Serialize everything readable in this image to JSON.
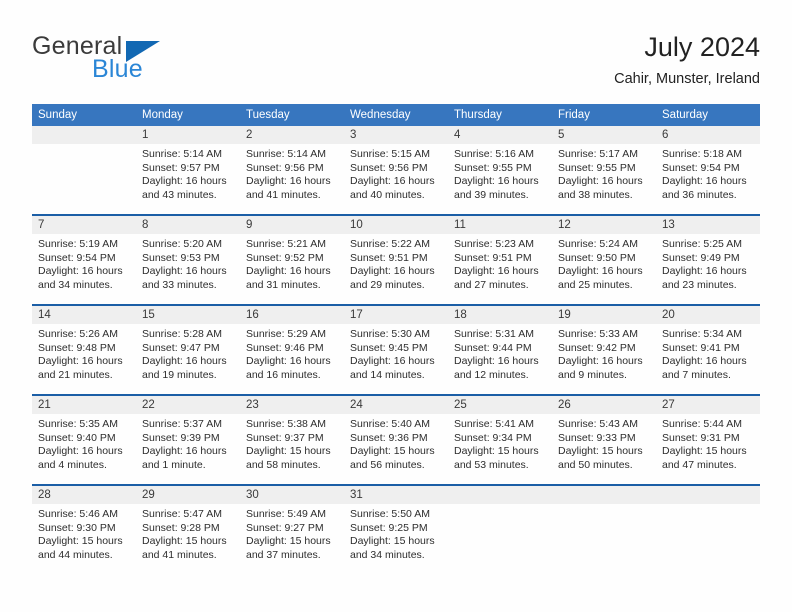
{
  "brand": {
    "name_top": "General",
    "name_bottom": "Blue",
    "triangle_color": "#1268b3",
    "blue_text_color": "#2b86d6"
  },
  "header": {
    "title": "July 2024",
    "subtitle": "Cahir, Munster, Ireland"
  },
  "theme": {
    "header_blue": "#3776bf",
    "week_rule_blue": "#1b5ea6",
    "number_band": "#efefef",
    "page_background": "#fefefe"
  },
  "weekdays": [
    "Sunday",
    "Monday",
    "Tuesday",
    "Wednesday",
    "Thursday",
    "Friday",
    "Saturday"
  ],
  "weeks": [
    {
      "numbers": [
        "",
        "1",
        "2",
        "3",
        "4",
        "5",
        "6"
      ],
      "cells": [
        {
          "sunrise": "",
          "sunset": "",
          "daylight1": "",
          "daylight2": ""
        },
        {
          "sunrise": "Sunrise: 5:14 AM",
          "sunset": "Sunset: 9:57 PM",
          "daylight1": "Daylight: 16 hours",
          "daylight2": "and 43 minutes."
        },
        {
          "sunrise": "Sunrise: 5:14 AM",
          "sunset": "Sunset: 9:56 PM",
          "daylight1": "Daylight: 16 hours",
          "daylight2": "and 41 minutes."
        },
        {
          "sunrise": "Sunrise: 5:15 AM",
          "sunset": "Sunset: 9:56 PM",
          "daylight1": "Daylight: 16 hours",
          "daylight2": "and 40 minutes."
        },
        {
          "sunrise": "Sunrise: 5:16 AM",
          "sunset": "Sunset: 9:55 PM",
          "daylight1": "Daylight: 16 hours",
          "daylight2": "and 39 minutes."
        },
        {
          "sunrise": "Sunrise: 5:17 AM",
          "sunset": "Sunset: 9:55 PM",
          "daylight1": "Daylight: 16 hours",
          "daylight2": "and 38 minutes."
        },
        {
          "sunrise": "Sunrise: 5:18 AM",
          "sunset": "Sunset: 9:54 PM",
          "daylight1": "Daylight: 16 hours",
          "daylight2": "and 36 minutes."
        }
      ]
    },
    {
      "numbers": [
        "7",
        "8",
        "9",
        "10",
        "11",
        "12",
        "13"
      ],
      "cells": [
        {
          "sunrise": "Sunrise: 5:19 AM",
          "sunset": "Sunset: 9:54 PM",
          "daylight1": "Daylight: 16 hours",
          "daylight2": "and 34 minutes."
        },
        {
          "sunrise": "Sunrise: 5:20 AM",
          "sunset": "Sunset: 9:53 PM",
          "daylight1": "Daylight: 16 hours",
          "daylight2": "and 33 minutes."
        },
        {
          "sunrise": "Sunrise: 5:21 AM",
          "sunset": "Sunset: 9:52 PM",
          "daylight1": "Daylight: 16 hours",
          "daylight2": "and 31 minutes."
        },
        {
          "sunrise": "Sunrise: 5:22 AM",
          "sunset": "Sunset: 9:51 PM",
          "daylight1": "Daylight: 16 hours",
          "daylight2": "and 29 minutes."
        },
        {
          "sunrise": "Sunrise: 5:23 AM",
          "sunset": "Sunset: 9:51 PM",
          "daylight1": "Daylight: 16 hours",
          "daylight2": "and 27 minutes."
        },
        {
          "sunrise": "Sunrise: 5:24 AM",
          "sunset": "Sunset: 9:50 PM",
          "daylight1": "Daylight: 16 hours",
          "daylight2": "and 25 minutes."
        },
        {
          "sunrise": "Sunrise: 5:25 AM",
          "sunset": "Sunset: 9:49 PM",
          "daylight1": "Daylight: 16 hours",
          "daylight2": "and 23 minutes."
        }
      ]
    },
    {
      "numbers": [
        "14",
        "15",
        "16",
        "17",
        "18",
        "19",
        "20"
      ],
      "cells": [
        {
          "sunrise": "Sunrise: 5:26 AM",
          "sunset": "Sunset: 9:48 PM",
          "daylight1": "Daylight: 16 hours",
          "daylight2": "and 21 minutes."
        },
        {
          "sunrise": "Sunrise: 5:28 AM",
          "sunset": "Sunset: 9:47 PM",
          "daylight1": "Daylight: 16 hours",
          "daylight2": "and 19 minutes."
        },
        {
          "sunrise": "Sunrise: 5:29 AM",
          "sunset": "Sunset: 9:46 PM",
          "daylight1": "Daylight: 16 hours",
          "daylight2": "and 16 minutes."
        },
        {
          "sunrise": "Sunrise: 5:30 AM",
          "sunset": "Sunset: 9:45 PM",
          "daylight1": "Daylight: 16 hours",
          "daylight2": "and 14 minutes."
        },
        {
          "sunrise": "Sunrise: 5:31 AM",
          "sunset": "Sunset: 9:44 PM",
          "daylight1": "Daylight: 16 hours",
          "daylight2": "and 12 minutes."
        },
        {
          "sunrise": "Sunrise: 5:33 AM",
          "sunset": "Sunset: 9:42 PM",
          "daylight1": "Daylight: 16 hours",
          "daylight2": "and 9 minutes."
        },
        {
          "sunrise": "Sunrise: 5:34 AM",
          "sunset": "Sunset: 9:41 PM",
          "daylight1": "Daylight: 16 hours",
          "daylight2": "and 7 minutes."
        }
      ]
    },
    {
      "numbers": [
        "21",
        "22",
        "23",
        "24",
        "25",
        "26",
        "27"
      ],
      "cells": [
        {
          "sunrise": "Sunrise: 5:35 AM",
          "sunset": "Sunset: 9:40 PM",
          "daylight1": "Daylight: 16 hours",
          "daylight2": "and 4 minutes."
        },
        {
          "sunrise": "Sunrise: 5:37 AM",
          "sunset": "Sunset: 9:39 PM",
          "daylight1": "Daylight: 16 hours",
          "daylight2": "and 1 minute."
        },
        {
          "sunrise": "Sunrise: 5:38 AM",
          "sunset": "Sunset: 9:37 PM",
          "daylight1": "Daylight: 15 hours",
          "daylight2": "and 58 minutes."
        },
        {
          "sunrise": "Sunrise: 5:40 AM",
          "sunset": "Sunset: 9:36 PM",
          "daylight1": "Daylight: 15 hours",
          "daylight2": "and 56 minutes."
        },
        {
          "sunrise": "Sunrise: 5:41 AM",
          "sunset": "Sunset: 9:34 PM",
          "daylight1": "Daylight: 15 hours",
          "daylight2": "and 53 minutes."
        },
        {
          "sunrise": "Sunrise: 5:43 AM",
          "sunset": "Sunset: 9:33 PM",
          "daylight1": "Daylight: 15 hours",
          "daylight2": "and 50 minutes."
        },
        {
          "sunrise": "Sunrise: 5:44 AM",
          "sunset": "Sunset: 9:31 PM",
          "daylight1": "Daylight: 15 hours",
          "daylight2": "and 47 minutes."
        }
      ]
    },
    {
      "numbers": [
        "28",
        "29",
        "30",
        "31",
        "",
        "",
        ""
      ],
      "cells": [
        {
          "sunrise": "Sunrise: 5:46 AM",
          "sunset": "Sunset: 9:30 PM",
          "daylight1": "Daylight: 15 hours",
          "daylight2": "and 44 minutes."
        },
        {
          "sunrise": "Sunrise: 5:47 AM",
          "sunset": "Sunset: 9:28 PM",
          "daylight1": "Daylight: 15 hours",
          "daylight2": "and 41 minutes."
        },
        {
          "sunrise": "Sunrise: 5:49 AM",
          "sunset": "Sunset: 9:27 PM",
          "daylight1": "Daylight: 15 hours",
          "daylight2": "and 37 minutes."
        },
        {
          "sunrise": "Sunrise: 5:50 AM",
          "sunset": "Sunset: 9:25 PM",
          "daylight1": "Daylight: 15 hours",
          "daylight2": "and 34 minutes."
        },
        {
          "sunrise": "",
          "sunset": "",
          "daylight1": "",
          "daylight2": ""
        },
        {
          "sunrise": "",
          "sunset": "",
          "daylight1": "",
          "daylight2": ""
        },
        {
          "sunrise": "",
          "sunset": "",
          "daylight1": "",
          "daylight2": ""
        }
      ]
    }
  ]
}
